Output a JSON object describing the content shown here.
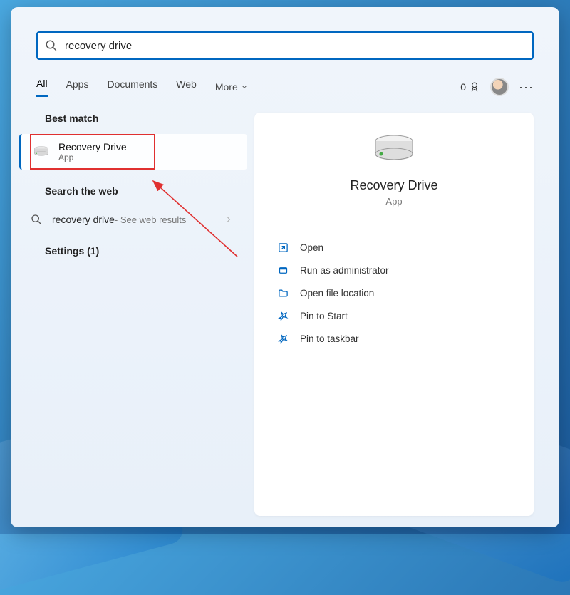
{
  "search": {
    "value": "recovery drive"
  },
  "tabs": [
    "All",
    "Apps",
    "Documents",
    "Web"
  ],
  "tab_more": "More",
  "reward_count": "0",
  "left": {
    "best_match_header": "Best match",
    "best_match": {
      "title": "Recovery Drive",
      "subtitle": "App"
    },
    "web_header": "Search the web",
    "web_result": {
      "query": "recovery drive",
      "suffix": " - See web results"
    },
    "settings_header": "Settings (1)"
  },
  "detail": {
    "title": "Recovery Drive",
    "subtitle": "App",
    "actions": [
      {
        "icon": "open",
        "label": "Open"
      },
      {
        "icon": "shield",
        "label": "Run as administrator"
      },
      {
        "icon": "folder",
        "label": "Open file location"
      },
      {
        "icon": "pin",
        "label": "Pin to Start"
      },
      {
        "icon": "pin",
        "label": "Pin to taskbar"
      }
    ]
  }
}
